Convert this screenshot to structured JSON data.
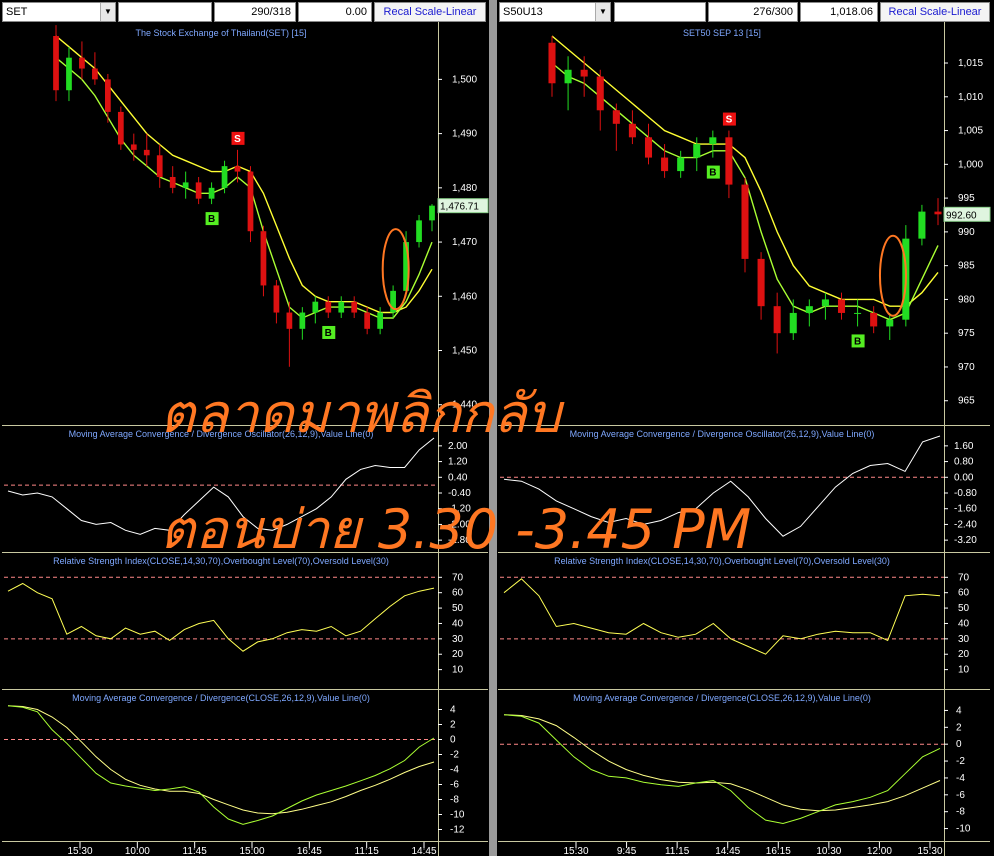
{
  "colors": {
    "up": "#22dd22",
    "down": "#dd1111",
    "ma_fast": "#aaff33",
    "ma_slow": "#ffff33",
    "osc": "#ffffff",
    "rsi": "#ffff55",
    "sig_buy": "#55ee22",
    "sig_sell": "#ee1111",
    "orange": "#ff7722",
    "axis_text": "#ffffff",
    "title_text": "#7fa8ff",
    "level": "#ff8888",
    "grid": "#333333"
  },
  "overlay": {
    "line1": "ตลาดมาพลิกกลับ",
    "line2": "ตอนบ่าย 3.30 -3.45 PM"
  },
  "panels": [
    {
      "toolbar": {
        "symbol": "SET",
        "counter": "290/318",
        "value": "0.00",
        "button": "Recal Scale-Linear"
      },
      "price": {
        "title": "The Stock Exchange of Thailand(SET) [15]",
        "yticks": [
          1500,
          1490,
          1480,
          1470,
          1460,
          1450,
          1440
        ],
        "ylim": [
          1437,
          1508
        ],
        "last": "1,476.71",
        "last_value": 1476.71
      },
      "oscillator": {
        "title": "Moving Average Convergence / Divergence Oscillator(26,12,9),Value Line(0)",
        "ytick_labels": [
          "2.00",
          "1.20",
          "0.40",
          "-0.40",
          "-1.20",
          "-2.00",
          "-2.80"
        ],
        "yticks": [
          2.0,
          1.2,
          0.4,
          -0.4,
          -1.2,
          -2.0,
          -2.8
        ],
        "ylim": [
          -3.2,
          2.4
        ]
      },
      "rsi": {
        "title": "Relative Strength Index(CLOSE,14,30,70),Overbought Level(70),Oversold Level(30)",
        "yticks": [
          70,
          60,
          50,
          40,
          30,
          20,
          10
        ],
        "ylim": [
          0,
          78
        ]
      },
      "macd": {
        "title": "Moving Average Convergence / Divergence(CLOSE,26,12,9),Value Line(0)",
        "yticks": [
          4,
          2,
          0,
          -2,
          -4,
          -6,
          -8,
          -10,
          -12
        ],
        "ylim": [
          -13,
          5
        ]
      },
      "xticks": [
        "15:30",
        "10:00",
        "11:45",
        "15:00",
        "16:45",
        "11:15",
        "14:45"
      ]
    },
    {
      "toolbar": {
        "symbol": "S50U13",
        "counter": "276/300",
        "value": "1,018.06",
        "button": "Recal Scale-Linear"
      },
      "price": {
        "title": "SET50 SEP 13   [15]",
        "yticks": [
          1015,
          1010,
          1005,
          1000,
          995,
          990,
          985,
          980,
          975,
          970,
          965
        ],
        "ylim": [
          962,
          1019
        ],
        "last": "992.60",
        "last_value": 992.6
      },
      "oscillator": {
        "title": "Moving Average Convergence / Divergence Oscillator(26,12,9),Value Line(0)",
        "ytick_labels": [
          "1.60",
          "0.80",
          "0.00",
          "-0.80",
          "-1.60",
          "-2.40",
          "-3.20"
        ],
        "yticks": [
          1.6,
          0.8,
          0.0,
          -0.8,
          -1.6,
          -2.4,
          -3.2
        ],
        "ylim": [
          -3.6,
          2.0
        ]
      },
      "rsi": {
        "title": "Relative Strength Index(CLOSE,14,30,70),Overbought Level(70),Oversold Level(30)",
        "yticks": [
          70,
          60,
          50,
          40,
          30,
          20,
          10
        ],
        "ylim": [
          0,
          78
        ]
      },
      "macd": {
        "title": "Moving Average Convergence / Divergence(CLOSE,26,12,9),Value Line(0)",
        "yticks": [
          4,
          2,
          0,
          -2,
          -4,
          -6,
          -8,
          -10
        ],
        "ylim": [
          -11,
          5
        ]
      },
      "xticks": [
        "15:30",
        "9:45",
        "11:15",
        "14:45",
        "16:15",
        "10:30",
        "12:00",
        "15:30"
      ]
    }
  ],
  "chart_data": [
    {
      "type": "candlestick",
      "title": "The Stock Exchange of Thailand(SET) [15]",
      "ohlc": [
        [
          1508,
          1510,
          1496,
          1498
        ],
        [
          1498,
          1506,
          1496,
          1504
        ],
        [
          1504,
          1507,
          1500,
          1502
        ],
        [
          1502,
          1505,
          1499,
          1500
        ],
        [
          1500,
          1501,
          1492,
          1494
        ],
        [
          1494,
          1495,
          1487,
          1488
        ],
        [
          1488,
          1490,
          1485,
          1487
        ],
        [
          1487,
          1490,
          1484,
          1486
        ],
        [
          1486,
          1488,
          1480,
          1482
        ],
        [
          1482,
          1484,
          1479,
          1480
        ],
        [
          1480,
          1483,
          1478,
          1481
        ],
        [
          1481,
          1482,
          1477,
          1478
        ],
        [
          1478,
          1481,
          1477,
          1480
        ],
        [
          1480,
          1485,
          1479,
          1484
        ],
        [
          1484,
          1487,
          1481,
          1483
        ],
        [
          1483,
          1484,
          1470,
          1472
        ],
        [
          1472,
          1473,
          1460,
          1462
        ],
        [
          1462,
          1463,
          1455,
          1457
        ],
        [
          1457,
          1459,
          1447,
          1454
        ],
        [
          1454,
          1458,
          1452,
          1457
        ],
        [
          1457,
          1460,
          1455,
          1459
        ],
        [
          1459,
          1460,
          1456,
          1457
        ],
        [
          1457,
          1460,
          1456,
          1459
        ],
        [
          1459,
          1460,
          1456,
          1457
        ],
        [
          1457,
          1458,
          1453,
          1454
        ],
        [
          1454,
          1458,
          1453,
          1457
        ],
        [
          1457,
          1462,
          1456,
          1461
        ],
        [
          1461,
          1472,
          1460,
          1470
        ],
        [
          1470,
          1475,
          1469,
          1474
        ],
        [
          1474,
          1477,
          1472,
          1476.71
        ]
      ],
      "ma_fast": [
        1504,
        1502,
        1500,
        1497,
        1493,
        1489,
        1486,
        1484,
        1482,
        1481,
        1480,
        1479,
        1479,
        1480,
        1482,
        1480,
        1472,
        1465,
        1458,
        1456,
        1457,
        1458,
        1458,
        1458,
        1457,
        1456,
        1456,
        1459,
        1464,
        1470
      ],
      "ma_slow": [
        1508,
        1506,
        1504,
        1502,
        1499,
        1496,
        1493,
        1490,
        1488,
        1486,
        1485,
        1484,
        1483,
        1483,
        1484,
        1483,
        1479,
        1473,
        1467,
        1462,
        1460,
        1459,
        1459,
        1459,
        1458,
        1457,
        1457,
        1458,
        1461,
        1465
      ],
      "signals": [
        {
          "type": "S",
          "x": 14
        },
        {
          "type": "B",
          "x": 12
        },
        {
          "type": "B",
          "x": 21
        }
      ],
      "oscillator": [
        -0.3,
        -0.5,
        -0.4,
        -0.6,
        -1.2,
        -1.8,
        -2.0,
        -1.9,
        -2.3,
        -2.5,
        -2.2,
        -2.3,
        -1.5,
        -0.8,
        -0.1,
        -0.6,
        -1.6,
        -2.2,
        -2.3,
        -2.0,
        -1.6,
        -1.2,
        -0.6,
        0.3,
        0.8,
        1.0,
        0.9,
        0.9,
        1.8,
        2.4
      ],
      "rsi": [
        61,
        66,
        60,
        56,
        33,
        38,
        32,
        30,
        37,
        33,
        35,
        29,
        36,
        40,
        42,
        30,
        22,
        28,
        30,
        34,
        36,
        35,
        38,
        32,
        35,
        43,
        51,
        58,
        61,
        63
      ],
      "macd_line": [
        4.5,
        4.3,
        3.7,
        1.3,
        -0.5,
        -2.5,
        -4.5,
        -5.8,
        -6.2,
        -6.5,
        -6.8,
        -6.6,
        -6.3,
        -7.0,
        -9.0,
        -10.6,
        -11.3,
        -10.8,
        -10.2,
        -9.2,
        -8.2,
        -7.4,
        -6.8,
        -6.2,
        -5.5,
        -4.8,
        -3.9,
        -2.8,
        -1.0,
        0.2
      ],
      "macd_signal": [
        4.5,
        4.4,
        4.0,
        3.0,
        1.6,
        -0.3,
        -2.3,
        -4.0,
        -5.3,
        -6.1,
        -6.6,
        -6.9,
        -6.9,
        -7.2,
        -8.0,
        -8.7,
        -9.4,
        -9.8,
        -9.9,
        -9.7,
        -9.3,
        -8.8,
        -8.3,
        -7.6,
        -6.8,
        -6.1,
        -5.3,
        -4.4,
        -3.6,
        -3.0
      ]
    },
    {
      "type": "candlestick",
      "title": "SET50 SEP 13   [15]",
      "ohlc": [
        [
          1018,
          1019,
          1010,
          1012
        ],
        [
          1012,
          1016,
          1008,
          1014
        ],
        [
          1014,
          1016,
          1010,
          1013
        ],
        [
          1013,
          1014,
          1005,
          1008
        ],
        [
          1008,
          1009,
          1002,
          1006
        ],
        [
          1006,
          1008,
          1003,
          1004
        ],
        [
          1004,
          1006,
          1000,
          1001
        ],
        [
          1001,
          1003,
          998,
          999
        ],
        [
          999,
          1002,
          998,
          1001
        ],
        [
          1001,
          1004,
          999,
          1003
        ],
        [
          1003,
          1005,
          1001,
          1004
        ],
        [
          1004,
          1005,
          995,
          997
        ],
        [
          997,
          998,
          984,
          986
        ],
        [
          986,
          987,
          977,
          979
        ],
        [
          979,
          981,
          972,
          975
        ],
        [
          975,
          980,
          974,
          978
        ],
        [
          978,
          980,
          976,
          979
        ],
        [
          979,
          981,
          977,
          980
        ],
        [
          980,
          981,
          977,
          978
        ],
        [
          978,
          980,
          976,
          978
        ],
        [
          978,
          979,
          975,
          976
        ],
        [
          976,
          978,
          974,
          977
        ],
        [
          977,
          991,
          976,
          989
        ],
        [
          989,
          994,
          988,
          993
        ],
        [
          993,
          995,
          991,
          992.6
        ]
      ],
      "ma_fast": [
        1015,
        1013,
        1012,
        1010,
        1008,
        1006,
        1004,
        1002,
        1001,
        1001,
        1002,
        1002,
        998,
        990,
        983,
        979,
        978,
        979,
        979,
        979,
        978,
        977,
        978,
        983,
        988
      ],
      "ma_slow": [
        1019,
        1017,
        1015,
        1013,
        1011,
        1009,
        1007,
        1005,
        1004,
        1003,
        1003,
        1003,
        1001,
        996,
        990,
        985,
        982,
        981,
        980,
        980,
        980,
        979,
        979,
        981,
        984
      ],
      "signals": [
        {
          "type": "S",
          "x": 11
        },
        {
          "type": "B",
          "x": 10
        },
        {
          "type": "B",
          "x": 19
        }
      ],
      "oscillator": [
        -0.1,
        -0.2,
        -0.6,
        -1.2,
        -1.6,
        -2.0,
        -2.3,
        -2.1,
        -2.4,
        -2.2,
        -1.8,
        -1.6,
        -0.8,
        -0.2,
        -1.0,
        -2.1,
        -3.0,
        -2.5,
        -1.5,
        -0.5,
        0.2,
        0.6,
        0.7,
        0.3,
        1.8,
        2.1
      ],
      "rsi": [
        60,
        69,
        58,
        38,
        40,
        37,
        34,
        33,
        40,
        34,
        31,
        33,
        40,
        30,
        25,
        20,
        32,
        30,
        33,
        35,
        34,
        34,
        29,
        58,
        59,
        58
      ],
      "macd_line": [
        3.5,
        3.3,
        2.5,
        0.5,
        -1.5,
        -3.0,
        -3.8,
        -4.0,
        -4.5,
        -4.8,
        -5.0,
        -4.6,
        -4.3,
        -5.5,
        -7.5,
        -9.0,
        -9.4,
        -8.8,
        -8.0,
        -7.2,
        -6.8,
        -6.3,
        -5.5,
        -3.5,
        -1.5,
        -0.5
      ],
      "macd_signal": [
        3.5,
        3.4,
        3.0,
        2.2,
        0.8,
        -0.7,
        -2.0,
        -3.0,
        -3.7,
        -4.2,
        -4.5,
        -4.6,
        -4.5,
        -4.7,
        -5.4,
        -6.3,
        -7.2,
        -7.7,
        -7.9,
        -7.8,
        -7.5,
        -7.2,
        -6.8,
        -6.1,
        -5.2,
        -4.3
      ]
    }
  ]
}
